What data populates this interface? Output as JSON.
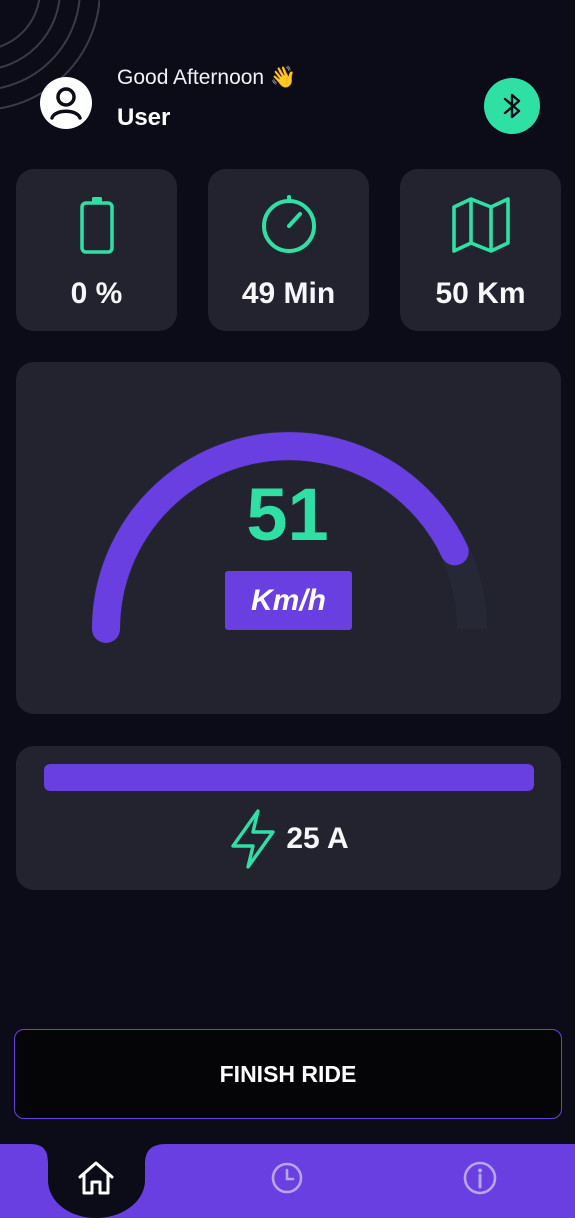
{
  "header": {
    "greeting": "Good Afternoon 👋",
    "username": "User"
  },
  "stats": [
    {
      "icon": "battery-icon",
      "value": "0 %"
    },
    {
      "icon": "timer-icon",
      "value": "49 Min"
    },
    {
      "icon": "map-icon",
      "value": "50 Km"
    }
  ],
  "speed": {
    "value": "51",
    "unit": "Km/h",
    "gauge_fraction": 0.86
  },
  "current": {
    "value": "25 A",
    "bar_fraction": 1.0
  },
  "finish_button": {
    "label": "FINISH RIDE"
  },
  "nav": {
    "items": [
      "home-icon",
      "clock-icon",
      "info-icon"
    ],
    "active": "home-icon"
  },
  "colors": {
    "background": "#0b0c17",
    "card": "#22232f",
    "accent_green": "#2fe0a5",
    "accent_purple": "#6a3fe2",
    "gauge_track": "#262836"
  }
}
